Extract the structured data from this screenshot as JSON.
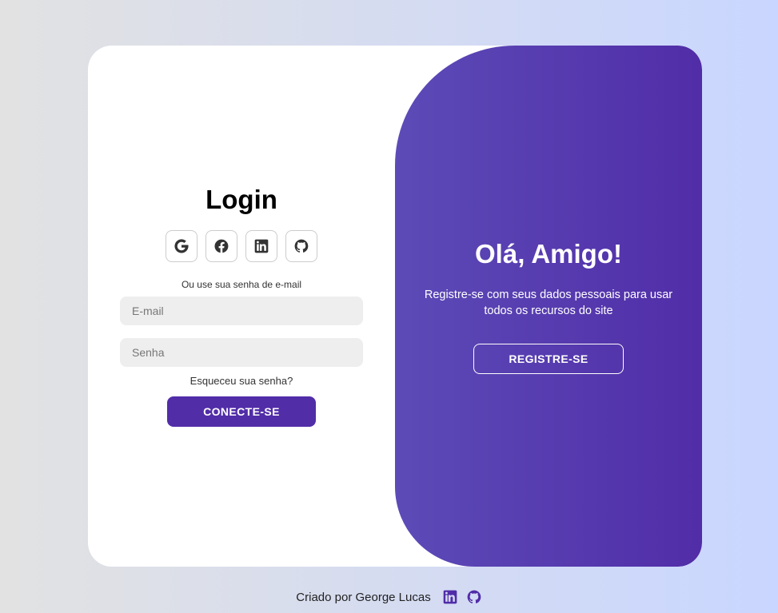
{
  "login": {
    "title": "Login",
    "social": [
      "google-icon",
      "facebook-icon",
      "linkedin-icon",
      "github-icon"
    ],
    "alt_text": "Ou use sua senha de e-mail",
    "email_placeholder": "E-mail",
    "password_placeholder": "Senha",
    "forgot_label": "Esqueceu sua senha?",
    "submit_label": "CONECTE-SE"
  },
  "welcome": {
    "title": "Olá, Amigo!",
    "text": "Registre-se com seus dados pessoais para usar todos os recursos do site",
    "register_label": "REGISTRE-SE"
  },
  "footer": {
    "text": "Criado por George Lucas",
    "icons": [
      "linkedin-icon",
      "github-icon"
    ]
  },
  "colors": {
    "accent": "#512da8",
    "gradient_start": "#5c4bb7",
    "background_left": "#e2e2e2",
    "background_right": "#c9d6ff"
  }
}
